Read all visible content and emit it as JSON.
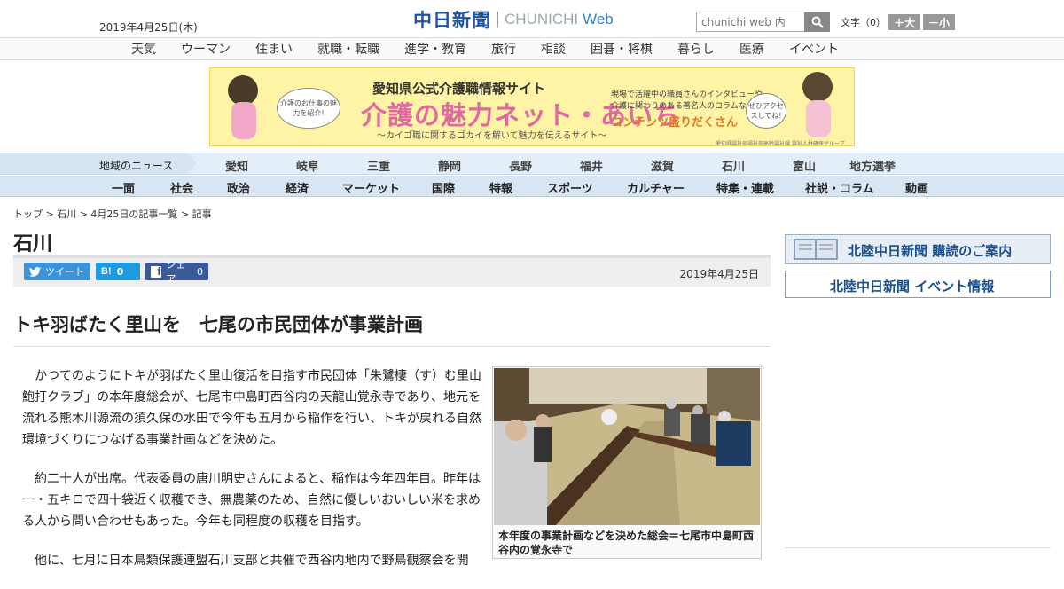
{
  "header": {
    "date": "2019年4月25日(木)",
    "logo_jp": "中日新聞",
    "logo_en": "CHUNICHI",
    "logo_web": "Web",
    "search_placeholder": "chunichi web 内",
    "font_size_label": "文字（0）",
    "font_plus": "＋大",
    "font_minus": "－小"
  },
  "category_nav": [
    "天気",
    "ウーマン",
    "住まい",
    "就職・転職",
    "進学・教育",
    "旅行",
    "相談",
    "囲碁・将棋",
    "暮らし",
    "医療",
    "イベント"
  ],
  "banner": {
    "line1": "愛知県公式介護職情報サイト",
    "line2": "介護の魅力ネット・あいち",
    "line3": "〜カイゴ職に関するゴカイを解いて魅力を伝えるサイト〜",
    "side_text1": "現場で活躍中の職員さんのインタビューや",
    "side_text2": "介護に関わりのある著名人のコラムなど",
    "side_highlight": "コンテンツ盛りだくさん",
    "bubble_left": "介護のお仕事の魅力を紹介!",
    "bubble_right": "ぜひアクセスしてね!",
    "fine_print": "愛知県福祉局福祉部高齢福祉課 福祉人材確保グループ"
  },
  "regional_nav": {
    "label": "地域のニュース",
    "items": [
      "愛知",
      "岐阜",
      "三重",
      "静岡",
      "長野",
      "福井",
      "滋賀",
      "石川",
      "富山",
      "地方選挙"
    ]
  },
  "main_nav": [
    "一面",
    "社会",
    "政治",
    "経済",
    "マーケット",
    "国際",
    "特報",
    "スポーツ",
    "カルチャー",
    "特集・連載",
    "社説・コラム",
    "動画"
  ],
  "breadcrumb": "トップ > 石川 > 4月25日の記事一覧 > 記事",
  "section_title": "石川",
  "share": {
    "tweet": "ツイート",
    "hatena_count": "0",
    "facebook_label": "シェア",
    "facebook_count": "0"
  },
  "article": {
    "date": "2019年4月25日",
    "headline": "トキ羽ばたく里山を　七尾の市民団体が事業計画",
    "paragraphs": [
      "かつてのようにトキが羽ばたく里山復活を目指す市民団体「朱鷺棲（す）む里山鮑打クラブ」の本年度総会が、七尾市中島町西谷内の天龍山覚永寺であり、地元を流れる熊木川源流の須久保の水田で今年も五月から稲作を行い、トキが戻れる自然環境づくりにつなげる事業計画などを決めた。",
      "約二十人が出席。代表委員の唐川明史さんによると、稲作は今年四年目。昨年は一・五キロで四十袋近く収穫でき、無農薬のため、自然に優しいおいしい米を求める人から問い合わせもあった。今年も同程度の収穫を目指す。",
      "他に、七月に日本鳥類保護連盟石川支部と共催で西谷内地内で野鳥観察会を開"
    ],
    "photo_caption": "本年度の事業計画などを決めた総会＝七尾市中島町西谷内の覚永寺で"
  },
  "sidebar": {
    "subscribe": "北陸中日新聞 購読のご案内",
    "events": "北陸中日新聞 イベント情報"
  }
}
